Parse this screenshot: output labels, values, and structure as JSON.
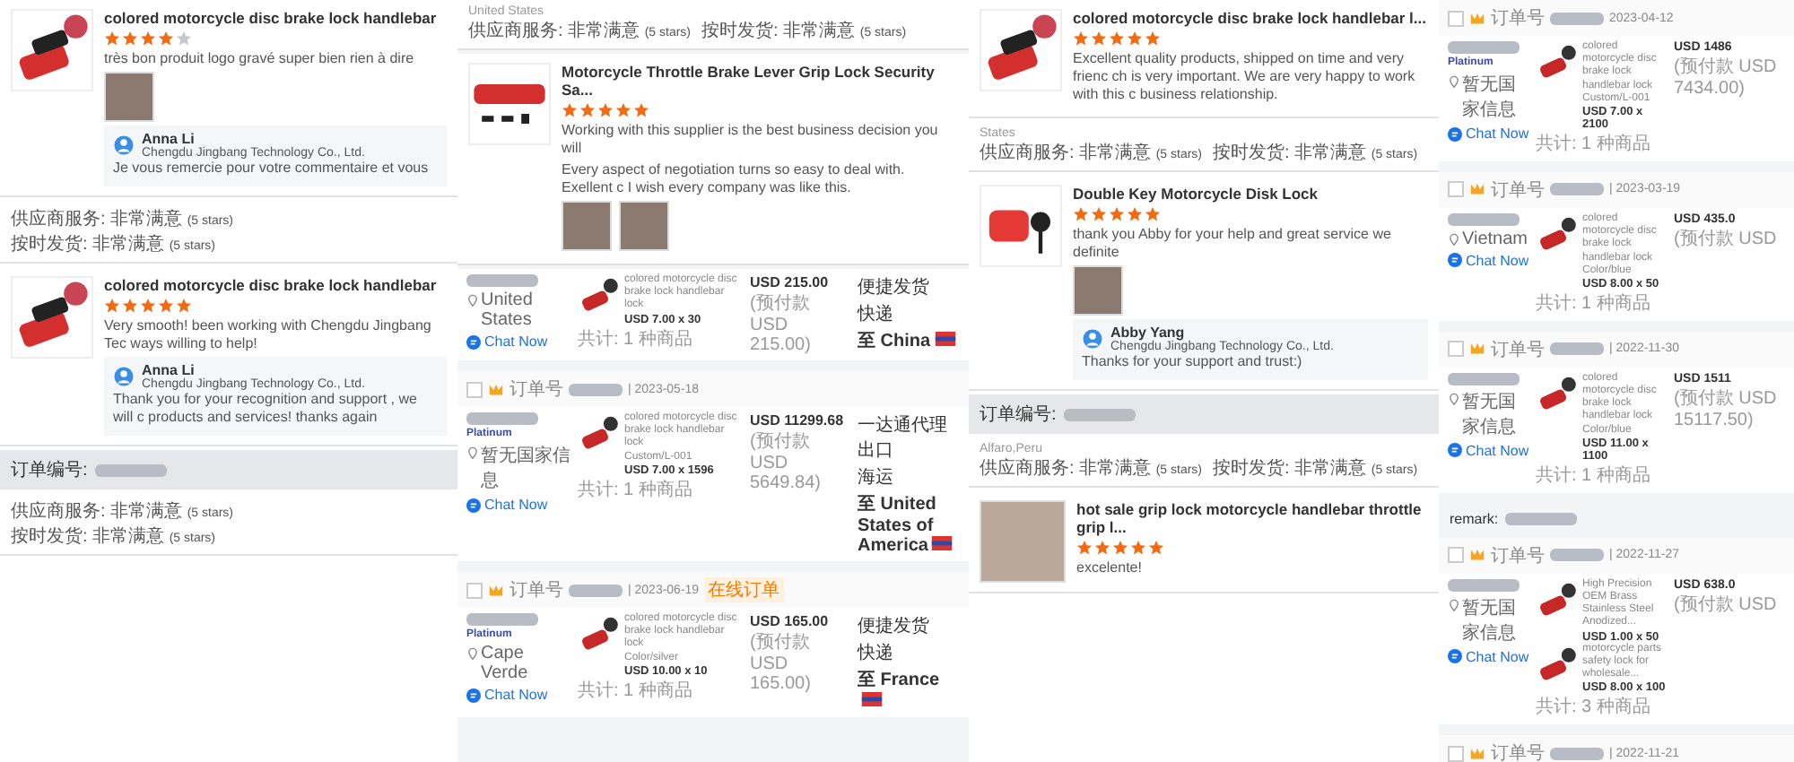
{
  "columns": [
    {
      "kind": "reviews",
      "blocks": [
        {
          "kind": "review",
          "title": "colored motorcycle disc brake lock handlebar",
          "stars": 4,
          "text": "très bon produit logo gravé super bien rien à dire",
          "photos": [
            {
              "kind": "photo"
            }
          ],
          "thumb": {
            "kind": "lock"
          },
          "reply": {
            "name": "Anna Li",
            "company": "Chengdu Jingbang Technology Co., Ltd.",
            "text": "Je vous remercie pour votre commentaire et vous"
          }
        },
        {
          "kind": "ratings",
          "items": [
            {
              "label": "供应商服务:",
              "value": "非常满意",
              "note": "(5 stars)"
            },
            {
              "label": "按时发货:",
              "value": "非常满意",
              "note": "(5 stars)"
            }
          ]
        },
        {
          "kind": "review",
          "title": "colored motorcycle disc brake lock handlebar",
          "stars": 5,
          "text": "Very smooth! been working with Chengdu Jingbang Tec ways willing to help!",
          "thumb": {
            "kind": "lock"
          },
          "reply": {
            "name": "Anna Li",
            "company": "Chengdu Jingbang Technology Co., Ltd.",
            "text": "Thank you for your recognition and support , we will c products and services! thanks again"
          }
        },
        {
          "kind": "order_bar",
          "label": "订单编号:"
        },
        {
          "kind": "ratings",
          "items": [
            {
              "label": "供应商服务:",
              "value": "非常满意",
              "note": "(5 stars)"
            },
            {
              "label": "按时发货:",
              "value": "非常满意",
              "note": "(5 stars)"
            }
          ]
        }
      ]
    },
    {
      "kind": "orders",
      "blocks": [
        {
          "kind": "ratings",
          "buyer": "United States",
          "items": [
            {
              "label": "供应商服务:",
              "value": "非常满意",
              "note": "(5 stars)"
            },
            {
              "label": "按时发货:",
              "value": "非常满意",
              "note": "(5 stars)"
            }
          ]
        },
        {
          "kind": "review",
          "title": "Motorcycle Throttle Brake Lever Grip Lock Security Sa...",
          "stars": 5,
          "text": "Working with this supplier is the best business decision you will",
          "text2": "Every aspect of negotiation turns so easy to deal with. Exellent c I wish every company was like this.",
          "photos": [
            {
              "kind": "photo"
            },
            {
              "kind": "photo"
            }
          ],
          "thumb": {
            "kind": "bar"
          }
        },
        {
          "kind": "order",
          "location": "United States",
          "chat": "Chat Now",
          "items": [
            {
              "name": "colored motorcycle disc brake lock handlebar lock",
              "qty": "USD 7.00 x 30"
            }
          ],
          "count": "共计: 1 种商品",
          "total": "USD 215.00",
          "prepaid": "(预付款 USD 215.00)",
          "shipping": [
            "便捷发货",
            "快递"
          ],
          "destination": "至 China"
        },
        {
          "kind": "order",
          "checked": false,
          "order_label": "订单号",
          "date": "| 2023-05-18",
          "level": "Platinum",
          "location": "暂无国家信息",
          "chat": "Chat Now",
          "items": [
            {
              "name": "colored motorcycle disc brake lock handlebar lock",
              "variant": "Custom/L-001",
              "qty": "USD 7.00 x 1596"
            }
          ],
          "count": "共计: 1 种商品",
          "total": "USD 11299.68",
          "prepaid": "(预付款 USD 5649.84)",
          "shipping": [
            "一达通代理出口",
            "海运"
          ],
          "destination": "至 United States of America"
        },
        {
          "kind": "order",
          "checked": false,
          "order_label": "订单号",
          "date": "| 2023-06-19",
          "tag": "在线订单",
          "level": "Platinum",
          "location": "Cape Verde",
          "chat": "Chat Now",
          "items": [
            {
              "name": "colored motorcycle disc brake lock handlebar lock",
              "variant": "Color/silver",
              "qty": "USD 10.00 x 10"
            }
          ],
          "count": "共计: 1 种商品",
          "total": "USD 165.00",
          "prepaid": "(预付款 USD 165.00)",
          "shipping": [
            "便捷发货",
            "快递"
          ],
          "destination": "至 France"
        }
      ]
    },
    {
      "kind": "reviews",
      "blocks": [
        {
          "kind": "review",
          "title": "colored motorcycle disc brake lock handlebar l...",
          "stars": 5,
          "text": "Excellent quality products, shipped on time and very frienc ch is very important. We are very happy to work with this c business relationship.",
          "thumb": {
            "kind": "lock"
          }
        },
        {
          "kind": "ratings",
          "buyer": "States",
          "items": [
            {
              "label": "供应商服务:",
              "value": "非常满意",
              "note": "(5 stars)"
            },
            {
              "label": "按时发货:",
              "value": "非常满意",
              "note": "(5 stars)"
            }
          ]
        },
        {
          "kind": "review",
          "title": "Double Key Motorcycle Disk Lock",
          "stars": 5,
          "text": "thank you Abby for your help and great service  we definite",
          "photos": [
            {
              "kind": "photo"
            }
          ],
          "thumb": {
            "kind": "key"
          },
          "reply": {
            "name": "Abby Yang",
            "company": "Chengdu Jingbang Technology Co., Ltd.",
            "text": "Thanks for your support and trust:)"
          }
        },
        {
          "kind": "order_bar",
          "label": "订单编号:"
        },
        {
          "kind": "ratings",
          "buyer": "Alfaro,Peru",
          "items": [
            {
              "label": "供应商服务:",
              "value": "非常满意",
              "note": "(5 stars)"
            },
            {
              "label": "按时发货:",
              "value": "非常满意",
              "note": "(5 stars)"
            }
          ]
        },
        {
          "kind": "review",
          "title": "hot sale grip lock motorcycle handlebar throttle grip l...",
          "stars": 5,
          "text": "excelente!",
          "thumb": {
            "kind": "photo"
          }
        }
      ]
    },
    {
      "kind": "orders",
      "blocks": [
        {
          "kind": "order",
          "checked": false,
          "order_label": "订单号",
          "date": "2023-04-12",
          "level": "Platinum",
          "location": "暂无国家信息",
          "chat": "Chat Now",
          "items": [
            {
              "name": "colored motorcycle disc brake lock handlebar lock",
              "variant": "Custom/L-001",
              "qty": "USD 7.00 x 2100"
            }
          ],
          "count": "共计: 1 种商品",
          "total": "USD 1486",
          "prepaid": "(预付款 USD 7434.00)"
        },
        {
          "kind": "order",
          "checked": false,
          "order_label": "订单号",
          "date": "| 2023-03-19",
          "location": "Vietnam",
          "chat": "Chat Now",
          "items": [
            {
              "name": "colored motorcycle disc brake lock handlebar lock",
              "variant": "Color/blue",
              "qty": "USD 8.00 x 50"
            }
          ],
          "count": "共计: 1 种商品",
          "total": "USD 435.0",
          "prepaid": "(预付款 USD"
        },
        {
          "kind": "order",
          "checked": false,
          "order_label": "订单号",
          "date": "| 2022-11-30",
          "location": "暂无国家信息",
          "chat": "Chat Now",
          "items": [
            {
              "name": "colored motorcycle disc brake lock handlebar lock",
              "variant": "Color/blue",
              "qty": "USD 11.00 x 1100"
            }
          ],
          "count": "共计: 1 种商品",
          "total": "USD 1511",
          "prepaid": "(预付款 USD 15117.50)"
        },
        {
          "kind": "remark",
          "label": "remark:"
        },
        {
          "kind": "order",
          "checked": false,
          "order_label": "订单号",
          "date": "| 2022-11-27",
          "location": "暂无国家信息",
          "chat": "Chat Now",
          "items": [
            {
              "name": "High Precision OEM Brass Stainless Steel Anodized...",
              "qty": "USD 1.00 x 50"
            },
            {
              "name": "motorcycle parts safety lock for wholesale...",
              "qty": "USD 8.00 x 100"
            }
          ],
          "count": "共计: 3 种商品",
          "total": "USD 638.0",
          "prepaid": "(预付款 USD"
        },
        {
          "kind": "order_head",
          "checked": false,
          "order_label": "订单号",
          "date": "| 2022-11-21"
        }
      ]
    }
  ]
}
